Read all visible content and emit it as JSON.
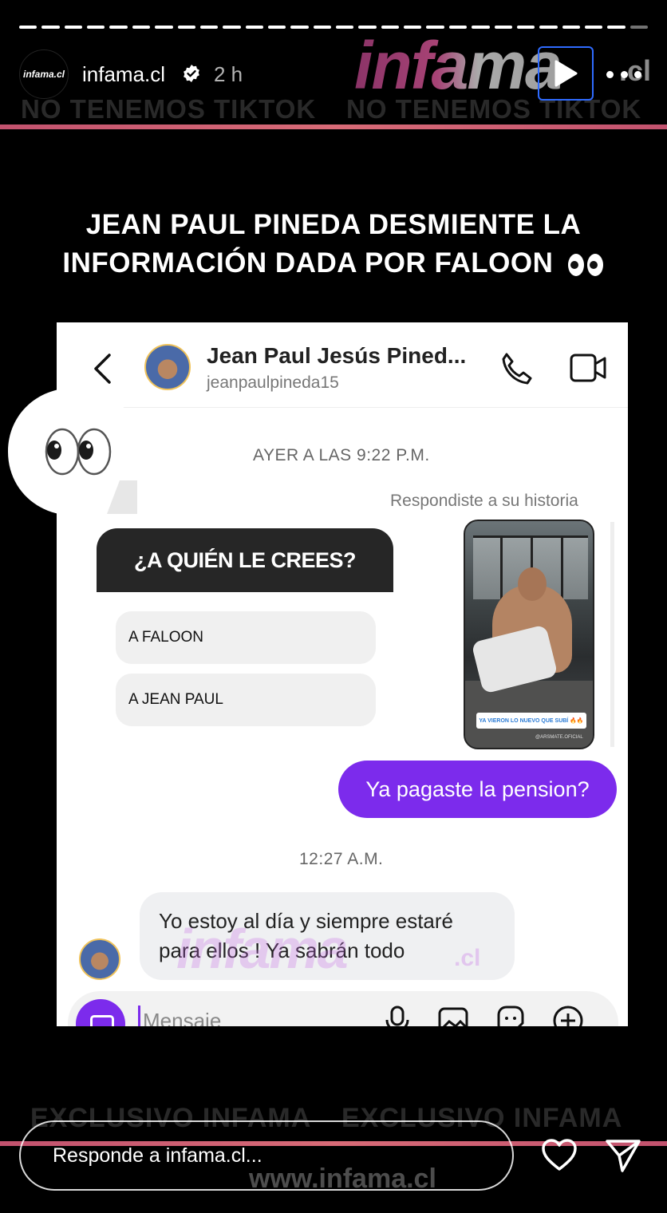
{
  "story": {
    "username": "infama.cl",
    "time": "2 h",
    "avatar_text": "infama.cl",
    "watermarks": {
      "top": "NO TENEMOS TIKTOK",
      "logo": "infama",
      "logo_suffix": ".cl",
      "bottom": "EXCLUSIVO INFAMA",
      "url": "www.infama.cl"
    },
    "progress_segments": 28,
    "progress_done": 27,
    "headline": "JEAN PAUL PINEDA DESMIENTE LA INFORMACIÓN DADA POR FALOON",
    "reply_placeholder": "Responde a infama.cl...",
    "colors": {
      "accent_strip": "#c2526e",
      "message_purple": "#7c2bec"
    }
  },
  "chat": {
    "name": "Jean Paul Jesús Pined...",
    "handle": "jeanpaulpineda15",
    "timestamp1": "AYER A LAS 9:22 P.M.",
    "replied_label": "Respondiste a su historia",
    "poll": {
      "question": "¿A QUIÉN LE CREES?",
      "options": [
        "A FALOON",
        "A JEAN PAUL"
      ]
    },
    "story_thumb_label": "YA VIERON LO NUEVO QUE SUBÍ 🔥🔥",
    "story_thumb_credit": "@ARSMATE.OFICIAL",
    "outgoing_message": "Ya pagaste la pension?",
    "timestamp2": "12:27 A.M.",
    "incoming_message": "Yo estoy al día y siempre estaré para ellos ! Ya sabrán todo",
    "compose_placeholder": "Mensaje"
  },
  "icons": [
    "verified-badge-icon",
    "play-icon",
    "more-icon",
    "back-arrow-icon",
    "phone-icon",
    "video-camera-icon",
    "eyes-icon",
    "camera-icon",
    "microphone-icon",
    "image-icon",
    "sticker-icon",
    "plus-icon",
    "heart-icon",
    "send-icon"
  ]
}
